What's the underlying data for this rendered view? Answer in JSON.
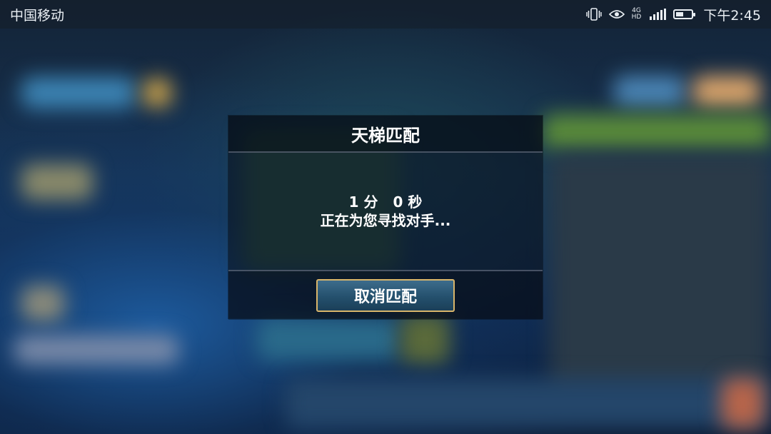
{
  "status_bar": {
    "carrier": "中国移动",
    "network_badge_top": "4G",
    "network_badge_bottom": "HD",
    "time": "下午2:45",
    "icons": [
      "vibrate-icon",
      "eye-comfort-icon",
      "signal-icon",
      "battery-icon"
    ]
  },
  "dialog": {
    "title": "天梯匹配",
    "timer_text": "1 分   0 秒",
    "message": "正在为您寻找对手...",
    "cancel_label": "取消匹配"
  },
  "colors": {
    "button_border": "#d9b56a",
    "button_fill": "#24506d",
    "text": "#ffffff"
  }
}
